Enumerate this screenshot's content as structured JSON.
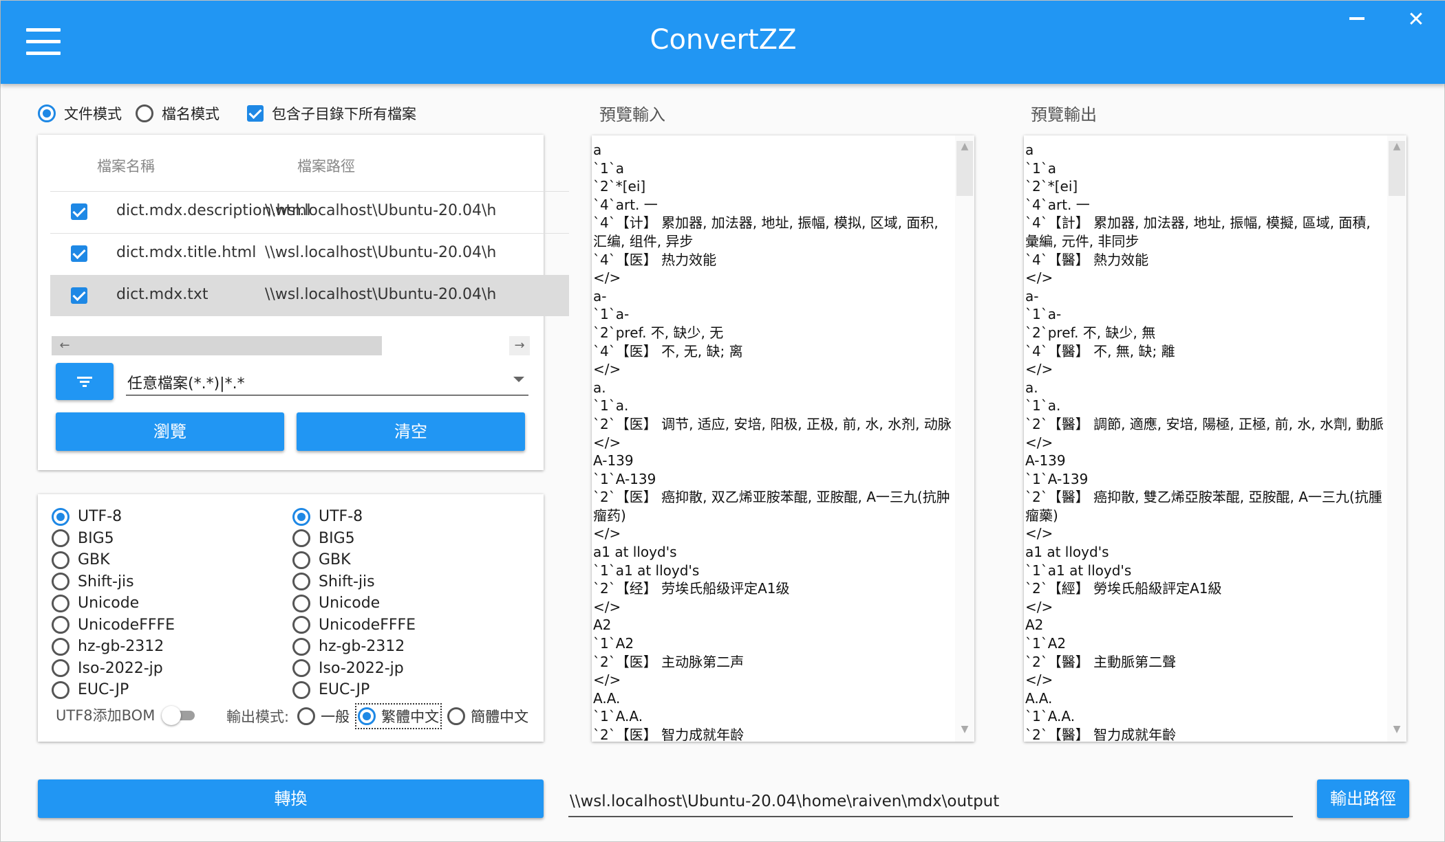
{
  "app": {
    "title": "ConvertZZ"
  },
  "icons": {
    "menu": "hamburger-icon",
    "minimize": "minimize-icon",
    "close": "close-icon",
    "filter": "filter-icon",
    "dropdown": "chevron-down-icon",
    "scroll_up": "arrow-up-icon",
    "scroll_down": "arrow-down-icon",
    "scroll_left": "arrow-left-icon",
    "scroll_right": "arrow-right-icon"
  },
  "colors": {
    "accent": "#2196f3",
    "radio_on": "#1e88e5"
  },
  "mode": {
    "file_mode": "文件模式",
    "name_mode": "檔名模式",
    "include_subdirs": "包含子目錄下所有檔案",
    "selected": "file_mode",
    "include_subdirs_checked": true
  },
  "file_table": {
    "headers": [
      "檔案名稱",
      "檔案路徑"
    ],
    "rows": [
      {
        "name": "dict.mdx.description.html",
        "path": "\\\\wsl.localhost\\Ubuntu-20.04\\h",
        "checked": true
      },
      {
        "name": "dict.mdx.title.html",
        "path": "\\\\wsl.localhost\\Ubuntu-20.04\\h",
        "checked": true
      },
      {
        "name": "dict.mdx.txt",
        "path": "\\\\wsl.localhost\\Ubuntu-20.04\\h",
        "checked": true,
        "selected": true
      }
    ]
  },
  "filter": {
    "value": "任意檔案(*.*)|*.*"
  },
  "buttons": {
    "browse": "瀏覽",
    "clear": "清空",
    "convert": "轉換",
    "output_path": "輸出路徑"
  },
  "encodings": {
    "options": [
      "UTF-8",
      "BIG5",
      "GBK",
      "Shift-jis",
      "Unicode",
      "UnicodeFFFE",
      "hz-gb-2312",
      "Iso-2022-jp",
      "EUC-JP"
    ],
    "input_selected": "UTF-8",
    "output_selected": "UTF-8"
  },
  "bom": {
    "label": "UTF8添加BOM",
    "on": false
  },
  "output_mode": {
    "label": "輸出模式:",
    "options": [
      "一般",
      "繁體中文",
      "簡體中文"
    ],
    "selected": "繁體中文"
  },
  "preview_input": {
    "label": "預覽輸入",
    "text": "a\n`1`a\n`2`*[ei]\n`4`art. 一\n`4`【计】 累加器, 加法器, 地址, 振幅, 模拟, 区域, 面积, 汇编, 组件, 异步\n`4`【医】 热力效能\n</>\na-\n`1`a-\n`2`pref. 不, 缺少, 无\n`4`【医】 不, 无, 缺; 离\n</>\na.\n`1`a.\n`2`【医】 调节, 适应, 安培, 阳极, 正极, 前, 水, 水剂, 动脉\n</>\nA-139\n`1`A-139\n`2`【医】 癌抑散, 双乙烯亚胺苯醌, 亚胺醌, A一三九(抗肿瘤药)\n</>\na1 at lloyd's\n`1`a1 at lloyd's\n`2`【经】 劳埃氏船级评定A1级\n</>\nA2\n`1`A2\n`2`【医】 主动脉第二声\n</>\nA.A.\n`1`A.A.\n`2`【医】 智力成就年龄"
  },
  "preview_output": {
    "label": "預覽輸出",
    "text": "a\n`1`a\n`2`*[ei]\n`4`art. 一\n`4`【計】 累加器, 加法器, 地址, 振幅, 模擬, 區域, 面積, 彙編, 元件, 非同步\n`4`【醫】 熱力效能\n</>\na-\n`1`a-\n`2`pref. 不, 缺少, 無\n`4`【醫】 不, 無, 缺; 離\n</>\na.\n`1`a.\n`2`【醫】 調節, 適應, 安培, 陽極, 正極, 前, 水, 水劑, 動脈\n</>\nA-139\n`1`A-139\n`2`【醫】 癌抑散, 雙乙烯亞胺苯醌, 亞胺醌, A一三九(抗腫瘤藥)\n</>\na1 at lloyd's\n`1`a1 at lloyd's\n`2`【經】 勞埃氏船級評定A1級\n</>\nA2\n`1`A2\n`2`【醫】 主動脈第二聲\n</>\nA.A.\n`1`A.A.\n`2`【醫】 智力成就年齡"
  },
  "output": {
    "path": "\\\\wsl.localhost\\Ubuntu-20.04\\home\\raiven\\mdx\\output"
  }
}
